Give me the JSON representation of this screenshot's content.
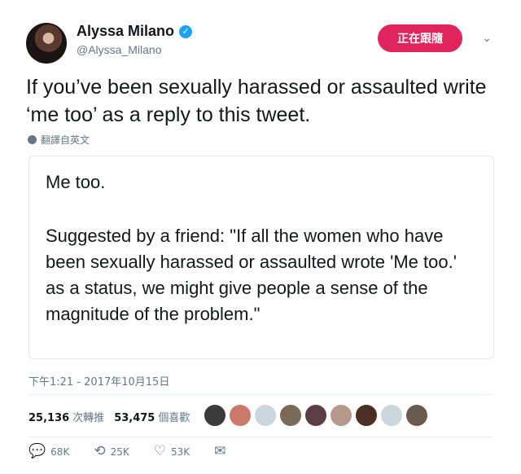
{
  "user": {
    "name": "Alyssa Milano",
    "handle": "@Alyssa_Milano",
    "follow_label": "正在跟隨"
  },
  "tweet": {
    "text": "If you’ve been sexually harassed or assaulted write ‘me too’ as a reply to this tweet.",
    "translate_label": "翻譯自英文",
    "quote": {
      "line1": "Me too.",
      "line2": "Suggested by a friend: \"If all the women who have been sexually harassed or assaulted wrote 'Me too.' as a status, we might give people a sense of the magnitude of the problem.\""
    },
    "timestamp": "下午1:21 - 2017年10月15日"
  },
  "stats": {
    "retweets_count": "25,136",
    "retweets_label": "次轉推",
    "likes_count": "53,475",
    "likes_label": "個喜歡"
  },
  "actions": {
    "replies": "68K",
    "retweets": "25K",
    "likes": "53K"
  },
  "colors": {
    "follow_button": "#e0245e",
    "verified": "#1da1f2",
    "muted_text": "#657786"
  }
}
